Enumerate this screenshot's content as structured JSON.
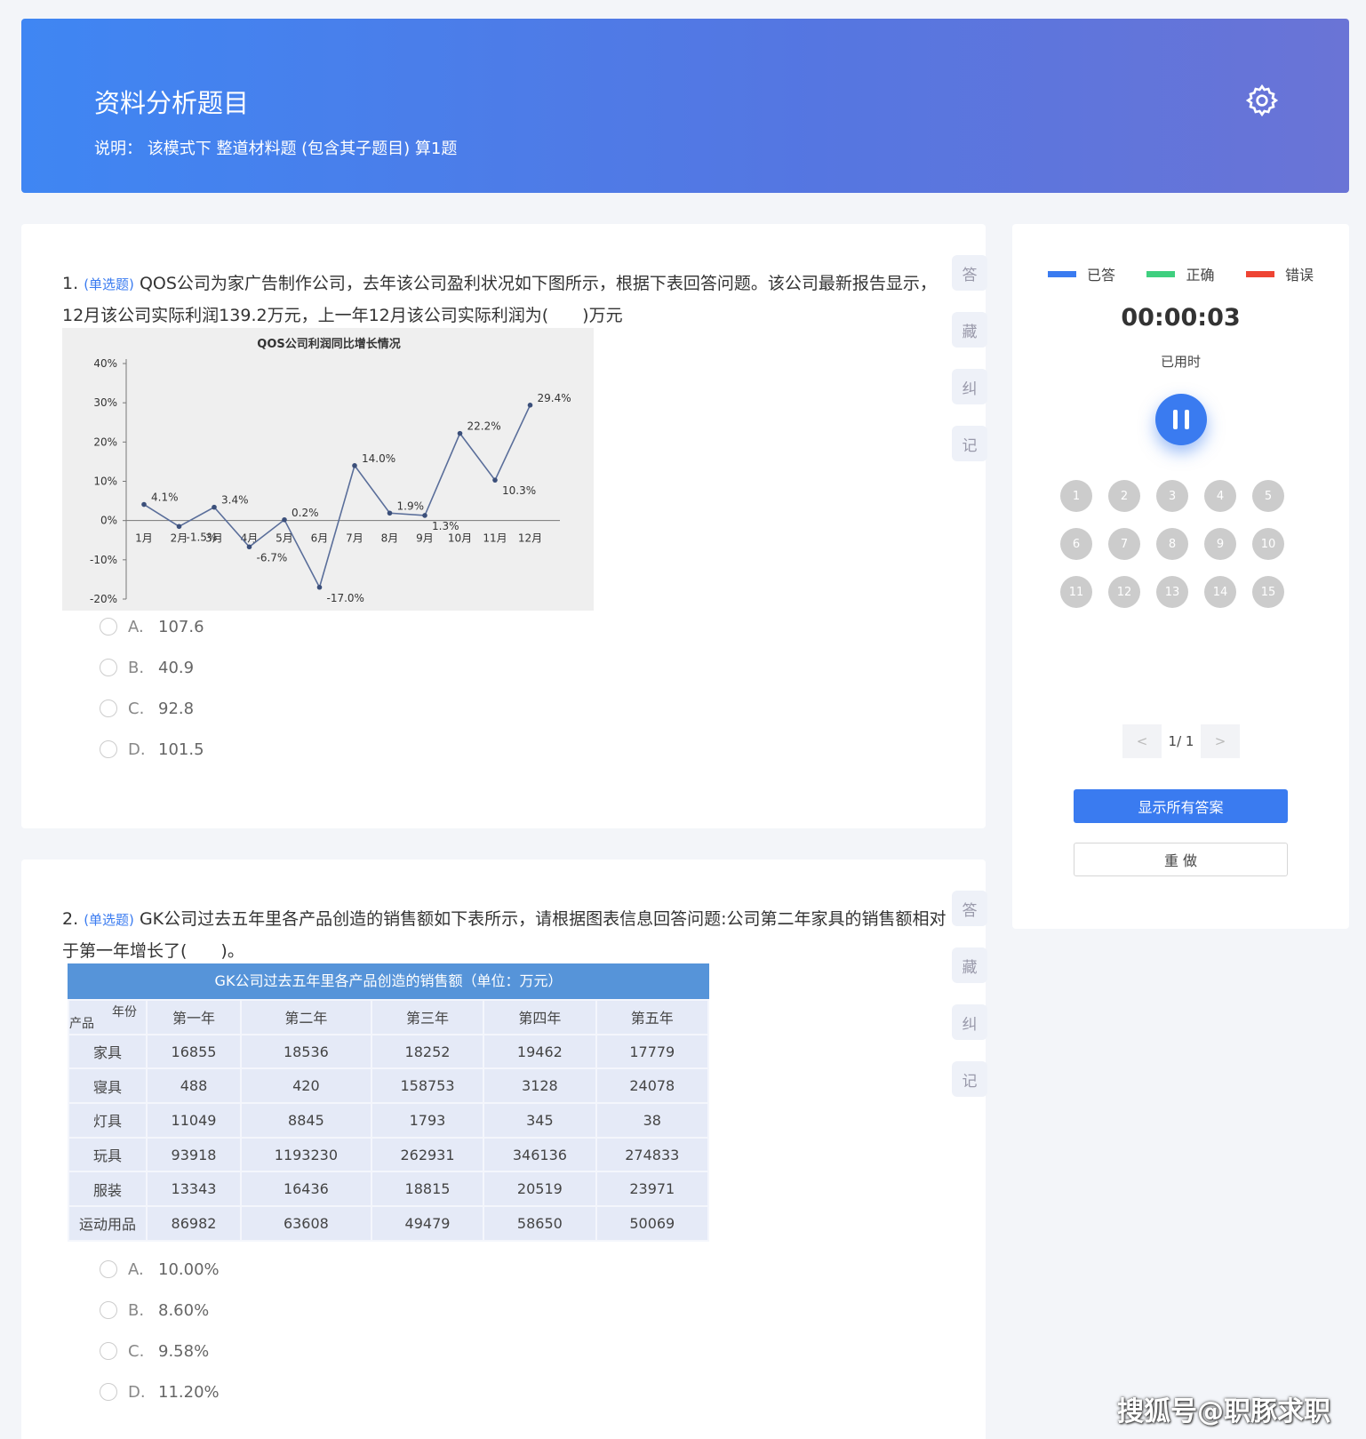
{
  "header": {
    "title": "资料分析题目",
    "desc": "说明： 该模式下 整道材料题 (包含其子题目) 算1题"
  },
  "tools": [
    "答",
    "藏",
    "纠",
    "记"
  ],
  "questions": [
    {
      "num": "1.",
      "tag": "(单选题)",
      "text": "QOS公司为家广告制作公司，去年该公司盈利状况如下图所示，根据下表回答问题。该公司最新报告显示，12月该公司实际利润139.2万元，上一年12月该公司实际利润为(　　)万元",
      "options": [
        {
          "letter": "A.",
          "text": "107.6"
        },
        {
          "letter": "B.",
          "text": "40.9"
        },
        {
          "letter": "C.",
          "text": "92.8"
        },
        {
          "letter": "D.",
          "text": "101.5"
        }
      ]
    },
    {
      "num": "2.",
      "tag": "(单选题)",
      "text": "GK公司过去五年里各产品创造的销售额如下表所示，请根据图表信息回答问题:公司第二年家具的销售额相对于第一年增长了(　　)。",
      "options": [
        {
          "letter": "A.",
          "text": "10.00%"
        },
        {
          "letter": "B.",
          "text": "8.60%"
        },
        {
          "letter": "C.",
          "text": "9.58%"
        },
        {
          "letter": "D.",
          "text": "11.20%"
        }
      ]
    }
  ],
  "chart_data": {
    "type": "line",
    "title": "QOS公司利润同比增长情况",
    "categories": [
      "1月",
      "2月",
      "3月",
      "4月",
      "5月",
      "6月",
      "7月",
      "8月",
      "9月",
      "10月",
      "11月",
      "12月"
    ],
    "values": [
      4.1,
      -1.5,
      3.4,
      -6.7,
      0.2,
      -17.0,
      14.0,
      1.9,
      1.3,
      22.2,
      10.3,
      29.4
    ],
    "point_labels": [
      "4.1%",
      "-1.5%",
      "3.4%",
      "-6.7%",
      "0.2%",
      "-17.0%",
      "14.0%",
      "1.9%",
      "1.3%",
      "22.2%",
      "10.3%",
      "29.4%"
    ],
    "yticks": [
      "40%",
      "30%",
      "20%",
      "10%",
      "0%",
      "-10%",
      "-20%"
    ],
    "ylim": [
      -20,
      40
    ]
  },
  "table": {
    "caption": "GK公司过去五年里各产品创造的销售额（单位：万元）",
    "corner_top": "年份",
    "corner_bottom": "产品",
    "headers": [
      "第一年",
      "第二年",
      "第三年",
      "第四年",
      "第五年"
    ],
    "rows": [
      {
        "name": "家具",
        "cells": [
          "16855",
          "18536",
          "18252",
          "19462",
          "17779"
        ]
      },
      {
        "name": "寝具",
        "cells": [
          "488",
          "420",
          "158753",
          "3128",
          "24078"
        ]
      },
      {
        "name": "灯具",
        "cells": [
          "11049",
          "8845",
          "1793",
          "345",
          "38"
        ]
      },
      {
        "name": "玩具",
        "cells": [
          "93918",
          "1193230",
          "262931",
          "346136",
          "274833"
        ]
      },
      {
        "name": "服装",
        "cells": [
          "13343",
          "16436",
          "18815",
          "20519",
          "23971"
        ]
      },
      {
        "name": "运动用品",
        "cells": [
          "86982",
          "63608",
          "49479",
          "58650",
          "50069"
        ]
      }
    ]
  },
  "panel": {
    "legend": [
      {
        "label": "已答",
        "color": "#3a7bf0"
      },
      {
        "label": "正确",
        "color": "#3fcf7f"
      },
      {
        "label": "错误",
        "color": "#ee4433"
      }
    ],
    "timer": "00:00:03",
    "timer_label": "已用时",
    "numbers": [
      "1",
      "2",
      "3",
      "4",
      "5",
      "6",
      "7",
      "8",
      "9",
      "10",
      "11",
      "12",
      "13",
      "14",
      "15"
    ],
    "pager": {
      "prev": "<",
      "info": "1/ 1",
      "next": ">"
    },
    "show_answers": "显示所有答案",
    "redo": "重 做"
  },
  "watermark": "搜狐号@职豚求职"
}
